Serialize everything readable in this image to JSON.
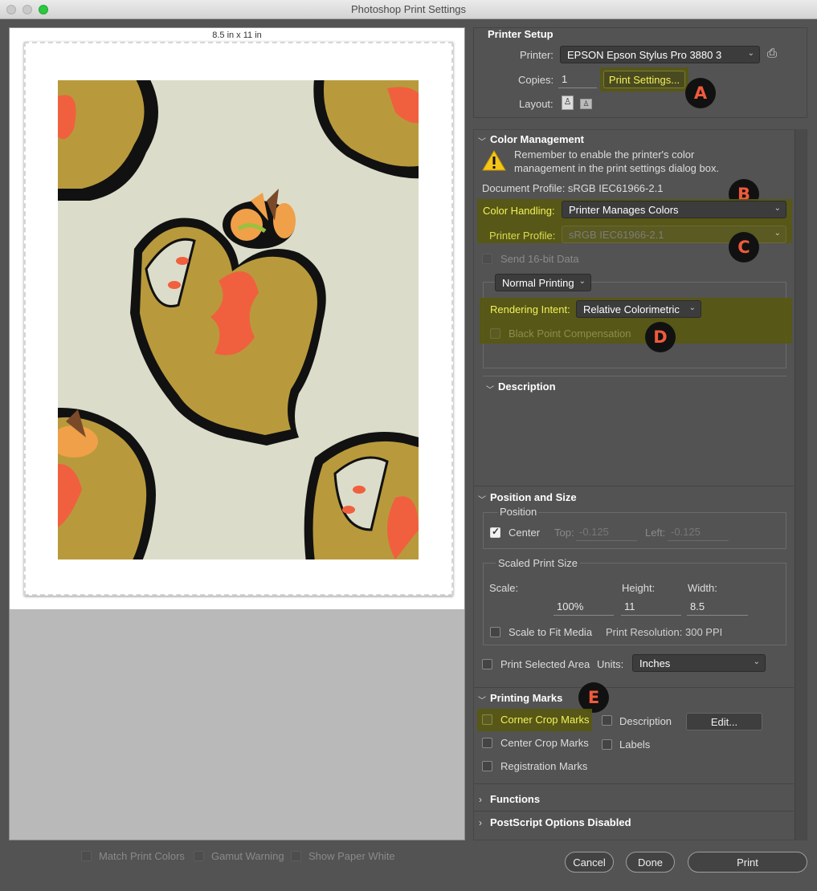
{
  "window": {
    "title": "Photoshop Print Settings"
  },
  "preview": {
    "paper_size": "8.5 in x 11 in"
  },
  "printer_setup": {
    "title": "Printer Setup",
    "printer_label": "Printer:",
    "printer_value": "EPSON Epson Stylus Pro 3880 3",
    "copies_label": "Copies:",
    "copies_value": "1",
    "print_settings_button": "Print Settings...",
    "layout_label": "Layout:"
  },
  "color_management": {
    "title": "Color Management",
    "warning_text_1": "Remember to enable the printer's color",
    "warning_text_2": "management in the print settings dialog box.",
    "document_profile": "Document Profile: sRGB IEC61966-2.1",
    "color_handling_label": "Color Handling:",
    "color_handling_value": "Printer Manages Colors",
    "printer_profile_label": "Printer Profile:",
    "printer_profile_value": "sRGB IEC61966-2.1",
    "send_16bit_label": "Send 16-bit Data",
    "normal_printing_value": "Normal Printing",
    "rendering_intent_label": "Rendering Intent:",
    "rendering_intent_value": "Relative Colorimetric",
    "black_point_label": "Black Point Compensation",
    "description_title": "Description"
  },
  "position_size": {
    "title": "Position and Size",
    "position_label": "Position",
    "center_label": "Center",
    "top_label": "Top:",
    "top_value": "-0.125",
    "left_label": "Left:",
    "left_value": "-0.125",
    "scaled_label": "Scaled Print Size",
    "scale_label": "Scale:",
    "scale_value": "100%",
    "height_label": "Height:",
    "height_value": "11",
    "width_label": "Width:",
    "width_value": "8.5",
    "scale_to_fit_label": "Scale to Fit Media",
    "print_resolution": "Print Resolution: 300 PPI",
    "print_selected_label": "Print Selected Area",
    "units_label": "Units:",
    "units_value": "Inches"
  },
  "printing_marks": {
    "title": "Printing Marks",
    "corner_crop": "Corner Crop Marks",
    "center_crop": "Center Crop Marks",
    "registration": "Registration Marks",
    "description": "Description",
    "labels": "Labels",
    "edit_button": "Edit..."
  },
  "collapsed_sections": {
    "functions": "Functions",
    "postscript": "PostScript Options Disabled"
  },
  "bottom_options": {
    "match_print": "Match Print Colors",
    "gamut": "Gamut Warning",
    "paper_white": "Show Paper White"
  },
  "buttons": {
    "cancel": "Cancel",
    "done": "Done",
    "print": "Print"
  },
  "badges": {
    "a": "A",
    "b": "B",
    "c": "C",
    "d": "D",
    "e": "E"
  },
  "colors": {
    "highlight": "#58581a",
    "badge_text": "#f05a3c",
    "artwork_bg": "#dcdcca",
    "mustard": "#b89a3c",
    "coral": "#f0603e"
  }
}
